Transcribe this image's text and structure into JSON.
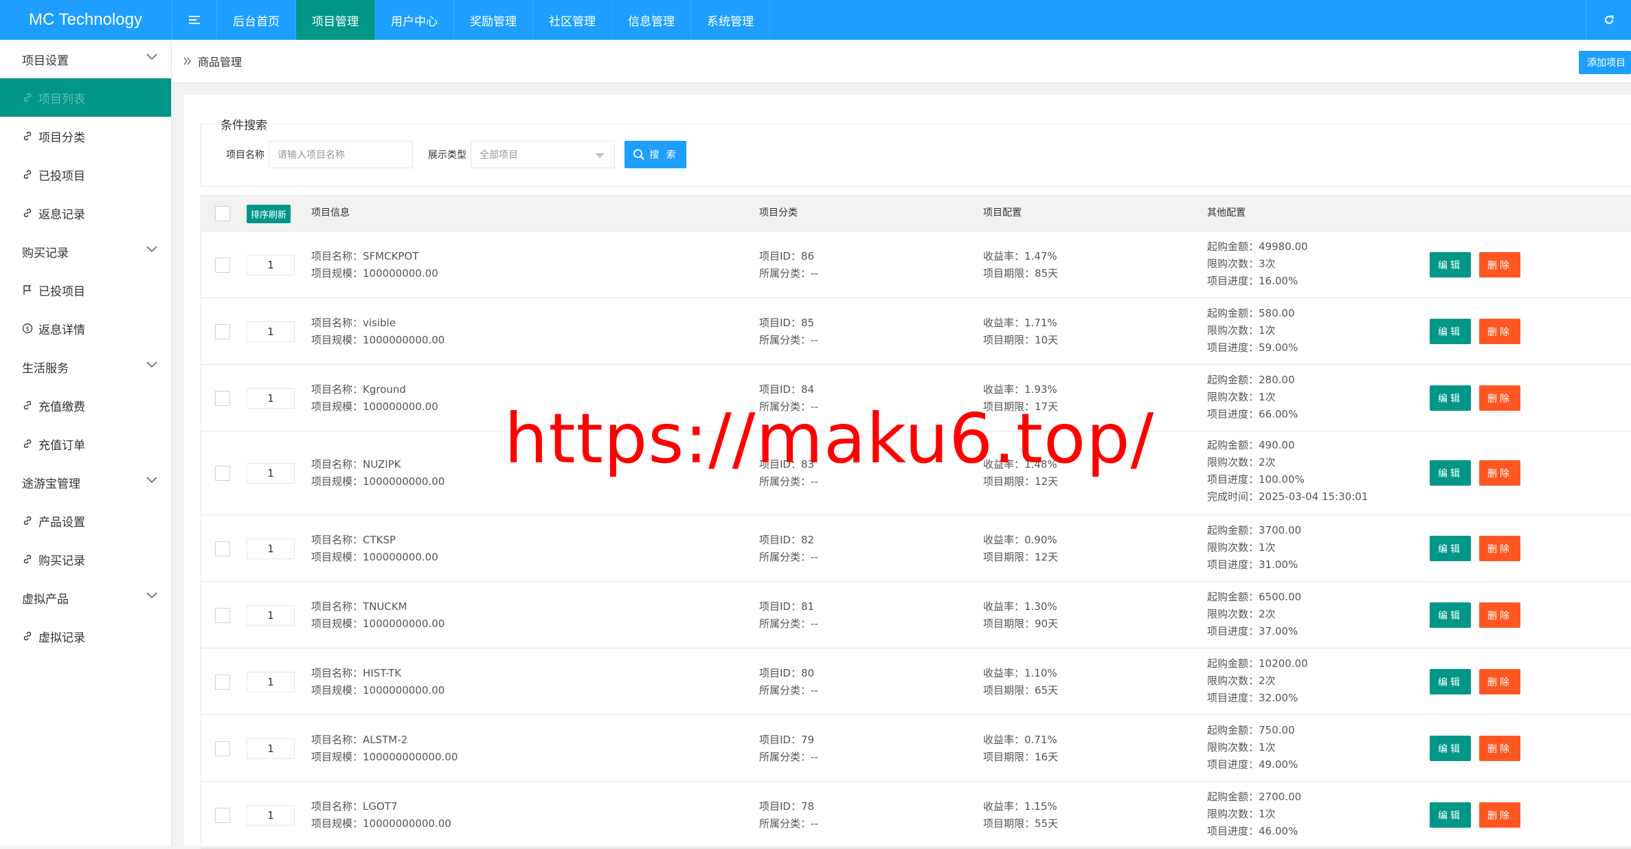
{
  "app": {
    "logo": "MC Technology"
  },
  "topnav": [
    {
      "label": "后台首页",
      "active": false
    },
    {
      "label": "项目管理",
      "active": true
    },
    {
      "label": "用户中心",
      "active": false
    },
    {
      "label": "奖励管理",
      "active": false
    },
    {
      "label": "社区管理",
      "active": false
    },
    {
      "label": "信息管理",
      "active": false
    },
    {
      "label": "系统管理",
      "active": false
    }
  ],
  "sidebar": {
    "g1": "项目设置",
    "i1": "项目列表",
    "i2": "项目分类",
    "i3": "已投项目",
    "i4": "返息记录",
    "g2": "购买记录",
    "i5": "已投项目",
    "i6": "返息详情",
    "g3": "生活服务",
    "i7": "充值缴费",
    "i8": "充值订单",
    "g4": "途游宝管理",
    "i9": "产品设置",
    "i10": "购买记录",
    "g5": "虚拟产品",
    "i11": "虚拟记录"
  },
  "breadcrumb": "商品管理",
  "add_button": "添加项目",
  "search": {
    "legend": "条件搜索",
    "name_label": "项目名称",
    "name_placeholder": "请输入项目名称",
    "type_label": "展示类型",
    "type_value": "全部项目",
    "button": "搜 索"
  },
  "table": {
    "sort_button": "排序刷新",
    "headers": {
      "info": "项目信息",
      "category": "项目分类",
      "config": "项目配置",
      "other": "其他配置"
    },
    "edit_label": "编辑",
    "delete_label": "删除",
    "rows": [
      {
        "order": "1",
        "name": "项目名称：SFMCKPOT",
        "scale": "项目规模：100000000.00",
        "id": "项目ID：86",
        "cat": "所属分类：--",
        "rate": "收益率：1.47%",
        "term": "项目期限：85天",
        "min": "起购金额：49980.00",
        "limit": "限购次数：3次",
        "progress": "项目进度：16.00%"
      },
      {
        "order": "1",
        "name": "项目名称：visible",
        "scale": "项目规模：1000000000.00",
        "id": "项目ID：85",
        "cat": "所属分类：--",
        "rate": "收益率：1.71%",
        "term": "项目期限：10天",
        "min": "起购金额：580.00",
        "limit": "限购次数：1次",
        "progress": "项目进度：59.00%"
      },
      {
        "order": "1",
        "name": "项目名称：Kground",
        "scale": "项目规模：100000000.00",
        "id": "项目ID：84",
        "cat": "所属分类：--",
        "rate": "收益率：1.93%",
        "term": "项目期限：17天",
        "min": "起购金额：280.00",
        "limit": "限购次数：1次",
        "progress": "项目进度：66.00%"
      },
      {
        "order": "1",
        "name": "项目名称：NUZIPK",
        "scale": "项目规模：1000000000.00",
        "id": "项目ID：83",
        "cat": "所属分类：--",
        "rate": "收益率：1.48%",
        "term": "项目期限：12天",
        "min": "起购金额：490.00",
        "limit": "限购次数：2次",
        "progress": "项目进度：100.00%",
        "done": "完成时间：2025-03-04 15:30:01"
      },
      {
        "order": "1",
        "name": "项目名称：CTKSP",
        "scale": "项目规模：100000000.00",
        "id": "项目ID：82",
        "cat": "所属分类：--",
        "rate": "收益率：0.90%",
        "term": "项目期限：12天",
        "min": "起购金额：3700.00",
        "limit": "限购次数：1次",
        "progress": "项目进度：31.00%"
      },
      {
        "order": "1",
        "name": "项目名称：TNUCKM",
        "scale": "项目规模：1000000000.00",
        "id": "项目ID：81",
        "cat": "所属分类：--",
        "rate": "收益率：1.30%",
        "term": "项目期限：90天",
        "min": "起购金额：6500.00",
        "limit": "限购次数：2次",
        "progress": "项目进度：37.00%"
      },
      {
        "order": "1",
        "name": "项目名称：HIST-TK",
        "scale": "项目规模：1000000000.00",
        "id": "项目ID：80",
        "cat": "所属分类：--",
        "rate": "收益率：1.10%",
        "term": "项目期限：65天",
        "min": "起购金额：10200.00",
        "limit": "限购次数：2次",
        "progress": "项目进度：32.00%"
      },
      {
        "order": "1",
        "name": "项目名称：ALSTM-2",
        "scale": "项目规模：100000000000.00",
        "id": "项目ID：79",
        "cat": "所属分类：--",
        "rate": "收益率：0.71%",
        "term": "项目期限：16天",
        "min": "起购金额：750.00",
        "limit": "限购次数：1次",
        "progress": "项目进度：49.00%"
      },
      {
        "order": "1",
        "name": "项目名称：LGOT7",
        "scale": "项目规模：10000000000.00",
        "id": "项目ID：78",
        "cat": "所属分类：--",
        "rate": "收益率：1.15%",
        "term": "项目期限：55天",
        "min": "起购金额：2700.00",
        "limit": "限购次数：1次",
        "progress": "项目进度：46.00%"
      }
    ]
  },
  "watermark": "https://maku6.top/"
}
